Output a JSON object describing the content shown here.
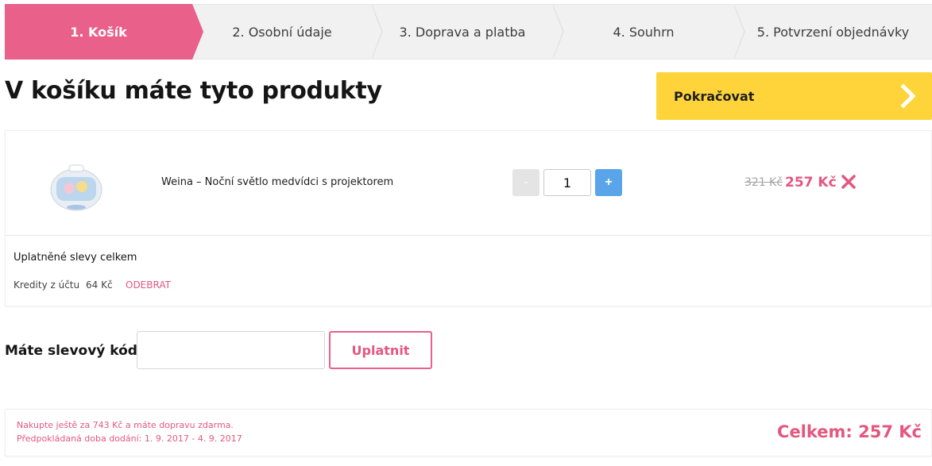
{
  "steps": [
    {
      "label": "1. Košík",
      "active": true
    },
    {
      "label": "2. Osobní údaje",
      "active": false
    },
    {
      "label": "3. Doprava a platba",
      "active": false
    },
    {
      "label": "4. Souhrn",
      "active": false
    },
    {
      "label": "5. Potvrzení objednávky",
      "active": false
    }
  ],
  "page": {
    "title": "V košíku máte tyto produkty",
    "continue_label": "Pokračovat"
  },
  "cart": {
    "items": [
      {
        "name": "Weina – Noční světlo medvídci s projektorem",
        "quantity": "1",
        "minus_label": "-",
        "plus_label": "+",
        "old_price": "321 Kč",
        "price": "257 Kč",
        "thumb_icon": "night-light-projector-image",
        "remove_icon": "close-icon"
      }
    ],
    "discounts": {
      "title": "Uplatněné slevy celkem",
      "credit_label": "Kredity z účtu",
      "credit_value": "64 Kč",
      "remove_label": "ODEBRAT"
    }
  },
  "coupon": {
    "label": "Máte slevový kód?",
    "input_value": "",
    "apply_label": "Uplatnit"
  },
  "summary": {
    "shipping_note": "Nakupte ještě za 743 Kč a máte dopravu zdarma.",
    "delivery_note": "Předpokládaná doba dodání: 1. 9. 2017 - 4. 9. 2017",
    "total": "Celkem: 257 Kč"
  },
  "colors": {
    "accent_pink": "#e9608a",
    "button_yellow": "#fed43a",
    "plus_blue": "#5aa5ea"
  }
}
